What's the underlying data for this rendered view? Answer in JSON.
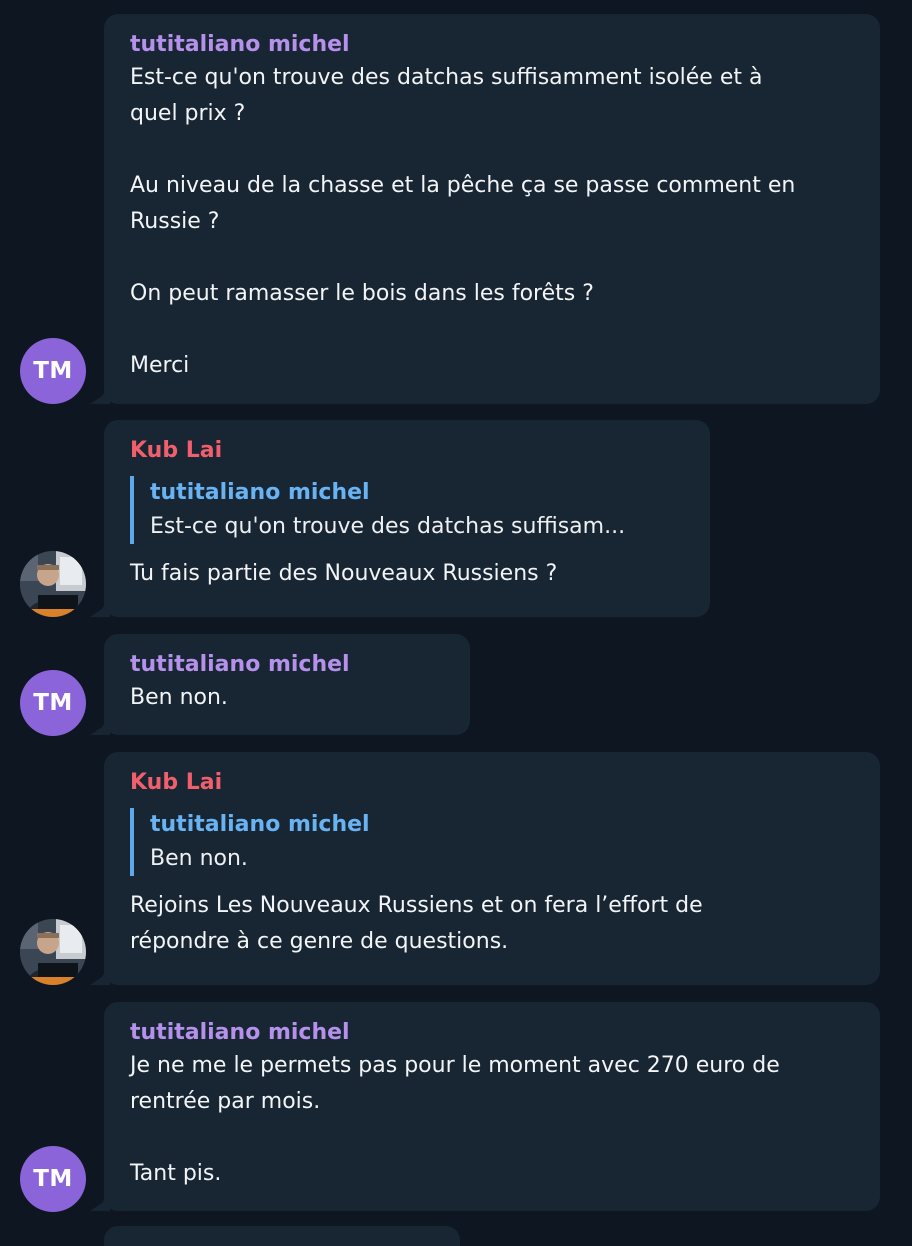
{
  "messages": [
    {
      "sender": "tutitaliano michel",
      "avatar_initials": "TM",
      "text": "Est-ce qu'on trouve des datchas suffisamment isolée et à\nquel prix ?\n\nAu niveau de la chasse et la pêche ça se passe comment en\nRussie ?\n\nOn peut ramasser le bois dans les forêts ?\n\nMerci"
    },
    {
      "sender": "Kub Lai",
      "avatar": "profile-photo",
      "reply_name": "tutitaliano michel",
      "reply_text": "Est-ce qu'on trouve des datchas suffisam...",
      "text": "Tu fais partie des Nouveaux Russiens ?"
    },
    {
      "sender": "tutitaliano michel",
      "avatar_initials": "TM",
      "text": "Ben non."
    },
    {
      "sender": "Kub Lai",
      "avatar": "profile-photo",
      "reply_name": "tutitaliano michel",
      "reply_text": "Ben non.",
      "text": "Rejoins Les Nouveaux Russiens et on fera l’effort de\nrépondre à ce genre de questions."
    },
    {
      "sender": "tutitaliano michel",
      "avatar_initials": "TM",
      "text": "Je ne me le permets pas pour le moment avec 270 euro de\nrentrée par mois.\n\nTant pis."
    }
  ],
  "colors": {
    "background": "#0e1621",
    "bubble": "#182533",
    "sender_purple": "#b591ec",
    "sender_red": "#f05f6b",
    "reply_accent": "#6ab3f3",
    "avatar_tm": "#8a64d8"
  }
}
